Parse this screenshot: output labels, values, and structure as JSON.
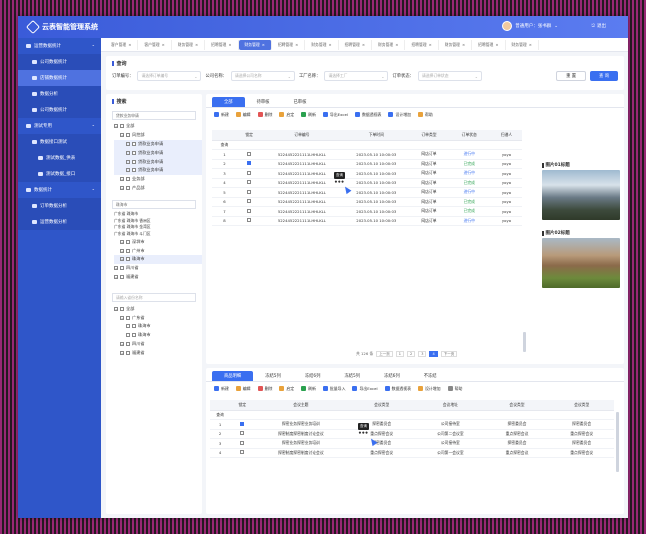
{
  "app": {
    "title": "云表智能管理系统",
    "user": "普通用户：张书群",
    "logout": "退出"
  },
  "sidebar": {
    "items": [
      {
        "label": "运营数据统计",
        "level": 0
      },
      {
        "label": "公司数据统计",
        "level": 1
      },
      {
        "label": "店铺数据统计",
        "level": 1,
        "active": true
      },
      {
        "label": "数据分析",
        "level": 1
      },
      {
        "label": "公司数据统计",
        "level": 1
      },
      {
        "label": "测试专用",
        "level": 0
      },
      {
        "label": "数据接口测试",
        "level": 1
      },
      {
        "label": "测试数据_供表",
        "level": 2
      },
      {
        "label": "测试数据_接口",
        "level": 2
      },
      {
        "label": "数据统计",
        "level": 0
      },
      {
        "label": "订单数据分析",
        "level": 1
      },
      {
        "label": "运营数据分析",
        "level": 1
      }
    ]
  },
  "tabs": [
    "客户管理",
    "客户管理",
    "财务管理",
    "招聘管理",
    "财务管理",
    "招聘管理",
    "财务管理",
    "招聘管理",
    "财务管理",
    "招聘管理",
    "财务管理",
    "招聘管理",
    "财务管理"
  ],
  "query": {
    "title": "查询",
    "fields": [
      {
        "label": "订单编号：",
        "placeholder": "请选择订单编号"
      },
      {
        "label": "公司名称：",
        "placeholder": "请选择公司名称"
      },
      {
        "label": "工厂名称：",
        "placeholder": "请选择工厂"
      },
      {
        "label": "订单状态：",
        "placeholder": "请选择订单状态"
      }
    ],
    "reset": "重 置",
    "submit": "查 询"
  },
  "search": {
    "title": "搜索",
    "input1": "贷款业务申请",
    "tree1": [
      {
        "label": "全部",
        "indent": 0
      },
      {
        "label": "风控部",
        "indent": 1
      },
      {
        "label": "贷款业务申请",
        "indent": 2,
        "sel": true
      },
      {
        "label": "贷款业务申请",
        "indent": 2,
        "sel": true
      },
      {
        "label": "贷款业务申请",
        "indent": 2,
        "sel": true
      },
      {
        "label": "贷款业务申请",
        "indent": 2,
        "sel": true
      },
      {
        "label": "业务部",
        "indent": 1
      },
      {
        "label": "产品部",
        "indent": 1
      }
    ],
    "input2": "珠海市",
    "addresses": [
      "广东省 珠海市",
      "广东省 珠海市 香洲区",
      "广东省 珠海市 金湾区",
      "广东省 珠海市 斗门区"
    ],
    "tree2": [
      {
        "label": "深圳市",
        "indent": 1
      },
      {
        "label": "广州市",
        "indent": 1
      },
      {
        "label": "珠海市",
        "indent": 1,
        "sel": true
      },
      {
        "label": "四川省",
        "indent": 0
      },
      {
        "label": "福建省",
        "indent": 0
      }
    ],
    "input3": "请输入省份名称",
    "tree3": [
      {
        "label": "全部",
        "indent": 0
      },
      {
        "label": "广东省",
        "indent": 1
      },
      {
        "label": "珠海市",
        "indent": 2
      },
      {
        "label": "珠海市",
        "indent": 2
      },
      {
        "label": "四川省",
        "indent": 1
      },
      {
        "label": "福建省",
        "indent": 1
      }
    ]
  },
  "main": {
    "subtabs": [
      "全部",
      "待审核",
      "已审核"
    ],
    "toolbar": [
      "新建",
      "编辑",
      "删除",
      "启定",
      "刷新",
      "导出Excel",
      "数据透视表",
      "设计增加",
      "帮助"
    ],
    "columns": [
      "",
      "锁定",
      "订单编号",
      "下单时间",
      "订单类型",
      "订单状态",
      "归谱人"
    ],
    "query_label": "查询",
    "tooltip": "查询",
    "rows": [
      [
        "1",
        "",
        "5224452221111LHHLKLL",
        "2023.05.10 10:00:03",
        "网店订单",
        "进行中",
        "yoyo"
      ],
      [
        "2",
        "x",
        "5224452221111LHHLKLL",
        "2023.05.10 10:00:03",
        "网店订单",
        "已完成",
        "yoyo"
      ],
      [
        "3",
        "",
        "5224452221111LHHLKLL",
        "2023.05.10 10:00:03",
        "网店订单",
        "进行中",
        "yoyo"
      ],
      [
        "4",
        "",
        "5224452221111LHHLKLL",
        "2023.05.10 10:00:03",
        "网店订单",
        "已完成",
        "yoyo"
      ],
      [
        "5",
        "",
        "5224452221111LHHLKLL",
        "2023.05.10 10:00:03",
        "网店订单",
        "进行中",
        "yoyo"
      ],
      [
        "6",
        "",
        "5224452221111LHHLKLL",
        "2023.05.10 10:00:03",
        "网店订单",
        "已完成",
        "yoyo"
      ],
      [
        "7",
        "",
        "5224452221111LHHLKLL",
        "2023.05.10 10:00:03",
        "网店订单",
        "已完成",
        "yoyo"
      ],
      [
        "8",
        "",
        "5224452221111LHHLKLL",
        "2023.05.10 10:00:03",
        "网店订单",
        "进行中",
        "yoyo"
      ]
    ],
    "pager": {
      "total": "共 126 条",
      "pages": [
        "1",
        "2",
        "3",
        "4"
      ],
      "current": "4",
      "prev": "上一页",
      "next": "下一页"
    },
    "images": [
      {
        "title": "图片01标题"
      },
      {
        "title": "图片02标题"
      }
    ]
  },
  "bottom": {
    "subtabs": [
      "商品明细",
      "冻结5列",
      "冻结6列",
      "冻结5列",
      "冻结6列",
      "不冻结"
    ],
    "toolbar": [
      "新建",
      "编辑",
      "删除",
      "启定",
      "刷新",
      "批量导入",
      "导出Excel",
      "数据透视表",
      "设计增加",
      "帮助"
    ],
    "columns": [
      "",
      "锁定",
      "会议主题",
      "会议类型",
      "会议地址",
      "会议类型",
      "会议类型"
    ],
    "query_label": "查询",
    "tooltip": "查询",
    "rows": [
      [
        "1",
        "x",
        "探密业务探密业务培训",
        "探密委员会",
        "公司接待室",
        "探密委员会",
        "探密委员会"
      ],
      [
        "2",
        "",
        "探密制度探密制度讨论会议",
        "重点探密会议",
        "公司第二会议室",
        "重点探密会议",
        "重点探密会议"
      ],
      [
        "3",
        "",
        "探密业务探密业务培训",
        "探密委员会",
        "公司接待室",
        "探密委员会",
        "探密委员会"
      ],
      [
        "4",
        "",
        "探密制度探密制度讨论会议",
        "重点探密会议",
        "公司第一会议室",
        "重点探密会议",
        "重点探密会议"
      ]
    ]
  }
}
